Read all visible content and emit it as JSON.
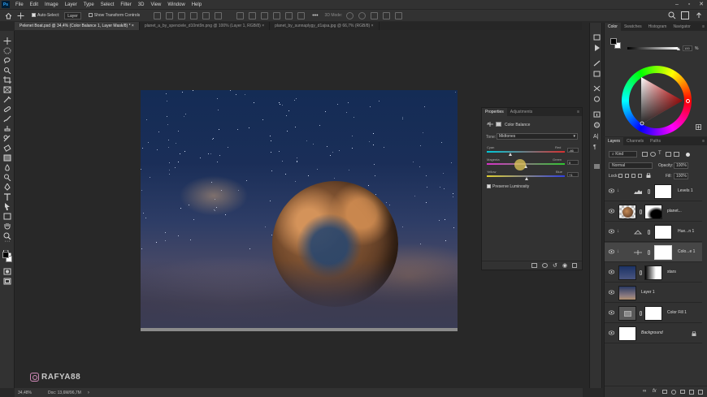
{
  "app": {
    "logo": "Ps"
  },
  "menubar": {
    "items": [
      "File",
      "Edit",
      "Image",
      "Layer",
      "Type",
      "Select",
      "Filter",
      "3D",
      "View",
      "Window",
      "Help"
    ]
  },
  "options": {
    "auto_select_label": "Auto-Select:",
    "auto_select_value": "Layer",
    "transform_label": "Show Transform Controls",
    "mode_3d": "3D Mode:"
  },
  "tabs": [
    {
      "label": "Pelenet Boat.psd @ 34,4% (Color Balance 1, Layer Mask/8) *",
      "active": true
    },
    {
      "label": "planet_a_by_spenciele_d10mt9n.png @ 100% (Layer 1, RGB/8)",
      "active": false
    },
    {
      "label": "planet_by_sunnaplygy_d1ajsa.jpg @ 66,7% (RGB/8)",
      "active": false
    }
  ],
  "status": {
    "zoom": "34,48%",
    "doc": "Doc: 13,6M/96,7M"
  },
  "watermark": {
    "text": "RAFYA88",
    "icon": "instagram-icon"
  },
  "properties": {
    "tabs": [
      "Properties",
      "Adjustments"
    ],
    "title": "Color Balance",
    "tone_label": "Tone:",
    "tone_value": "Midtones",
    "sliders": [
      {
        "left": "Cyan",
        "right": "Red",
        "value": "-46",
        "level": 0.3
      },
      {
        "left": "Magenta",
        "right": "Green",
        "value": "0",
        "level": 0.5
      },
      {
        "left": "Yellow",
        "right": "Blue",
        "value": "+1",
        "level": 0.51
      }
    ],
    "preserve_label": "Preserve Luminosity",
    "preserve_checked": true
  },
  "color_panel": {
    "tabs": [
      "Color",
      "Swatches",
      "Histogram",
      "Navigator"
    ],
    "brightness_value": "100",
    "brightness_unit": "%",
    "foreground": "#000000",
    "background": "#ffffff"
  },
  "layers_panel": {
    "tabs": [
      "Layers",
      "Channels",
      "Paths"
    ],
    "kind_label": "Kind",
    "blend_mode": "Normal",
    "opacity_label": "Opacity:",
    "opacity_value": "100%",
    "lock_label": "Lock:",
    "fill_label": "Fill:",
    "fill_value": "100%",
    "layers": [
      {
        "name": "Levels 1",
        "type": "adjustment",
        "clipped": true,
        "selected": false
      },
      {
        "name": "planet...",
        "type": "masked",
        "clipped": false,
        "selected": false
      },
      {
        "name": "Hue...n 1",
        "type": "adjustment",
        "clipped": true,
        "selected": false
      },
      {
        "name": "Colo...e 1",
        "type": "adjustment",
        "clipped": true,
        "selected": true
      },
      {
        "name": "stars",
        "type": "masked",
        "clipped": false,
        "selected": false
      },
      {
        "name": "Layer 1",
        "type": "pixel",
        "clipped": false,
        "selected": false
      },
      {
        "name": "Color Fill 1",
        "type": "fill",
        "clipped": false,
        "selected": false
      },
      {
        "name": "Background",
        "type": "background",
        "clipped": false,
        "selected": false
      }
    ]
  }
}
